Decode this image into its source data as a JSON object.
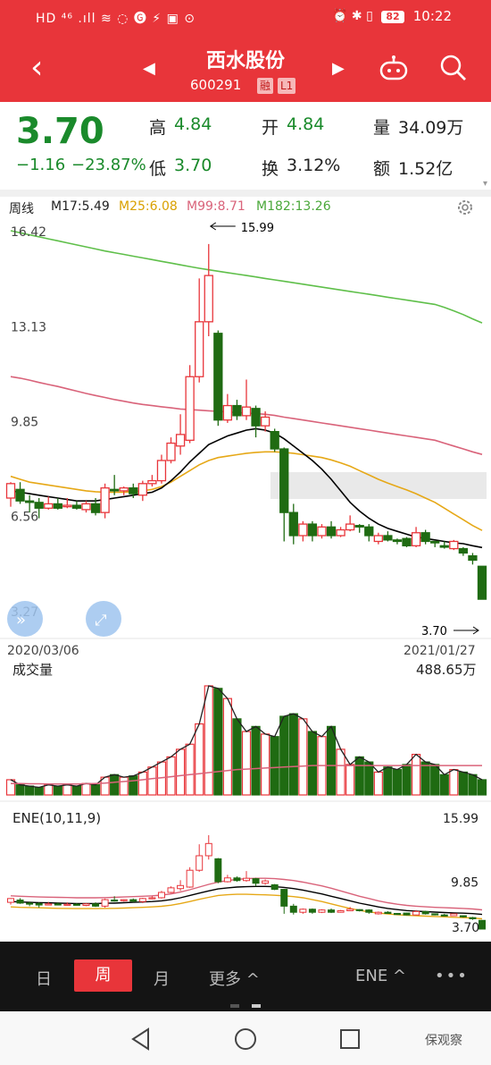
{
  "status": {
    "left": "HD ⁴⁶ .ıll ≋ ◌ 🅖 ⚡ ▣ ⊙",
    "icons": "⏰ ✱ ▯",
    "battery": "82",
    "time": "10:22"
  },
  "header": {
    "title": "西水股份",
    "code": "600291",
    "tag1": "融",
    "tag2": "L1",
    "back_icon": "back-arrow-icon",
    "prev_icon": "triangle-left-icon",
    "next_icon": "triangle-right-icon"
  },
  "quote": {
    "price": "3.70",
    "change": "−1.16",
    "pct": "−23.87%",
    "high_label": "高",
    "high": "4.84",
    "low_label": "低",
    "low": "3.70",
    "open_label": "开",
    "open": "4.84",
    "turn_label": "换",
    "turn": "3.12%",
    "vol_label": "量",
    "vol": "34.09万",
    "amt_label": "额",
    "amt": "1.52亿"
  },
  "ma": {
    "period": "周线",
    "m17": "M17:5.49",
    "m25": "M25:6.08",
    "m99": "M99:8.71",
    "m182": "M182:13.26"
  },
  "colors": {
    "red": "#e8353a",
    "up": "#e8353a",
    "down": "#1f6b12",
    "m17": "#000000",
    "m25": "#e6a817",
    "m99": "#d9637a",
    "m182": "#5fbf4a"
  },
  "chart_data": {
    "type": "candlestick",
    "price_axis_labels": [
      "16.42",
      "13.13",
      "9.85",
      "6.56",
      "3.27"
    ],
    "ylim": [
      3.27,
      16.42
    ],
    "start_date": "2020/03/06",
    "end_date": "2021/01/27",
    "max_label": "15.99",
    "min_label": "3.70",
    "candles": [
      [
        7.2,
        7.75,
        7.7,
        6.9
      ],
      [
        7.5,
        7.75,
        7.1,
        7.0
      ],
      [
        7.1,
        7.3,
        7.05,
        6.7
      ],
      [
        7.05,
        7.2,
        6.85,
        6.5
      ],
      [
        6.85,
        7.25,
        7.0,
        6.8
      ],
      [
        7.0,
        7.2,
        6.85,
        6.8
      ],
      [
        6.9,
        7.2,
        6.95,
        6.85
      ],
      [
        6.95,
        7.1,
        6.85,
        6.8
      ],
      [
        6.8,
        7.1,
        7.0,
        6.7
      ],
      [
        7.0,
        7.2,
        6.7,
        6.6
      ],
      [
        6.7,
        7.7,
        7.55,
        6.5
      ],
      [
        7.5,
        8.0,
        7.45,
        7.3
      ],
      [
        7.45,
        7.6,
        7.55,
        7.3
      ],
      [
        7.55,
        7.7,
        7.35,
        7.2
      ],
      [
        7.3,
        7.8,
        7.7,
        7.1
      ],
      [
        7.7,
        8.0,
        7.8,
        7.6
      ],
      [
        7.8,
        8.7,
        8.5,
        7.7
      ],
      [
        8.5,
        9.3,
        9.1,
        8.4
      ],
      [
        9.0,
        10.1,
        9.4,
        8.7
      ],
      [
        9.2,
        11.8,
        11.4,
        9.1
      ],
      [
        11.4,
        14.8,
        13.3,
        11.2
      ],
      [
        13.3,
        15.99,
        14.9,
        12.8
      ],
      [
        12.9,
        13.0,
        9.9,
        9.7
      ],
      [
        9.9,
        10.8,
        10.4,
        9.8
      ],
      [
        10.4,
        10.6,
        10.05,
        9.9
      ],
      [
        10.05,
        11.3,
        10.35,
        9.9
      ],
      [
        10.3,
        10.4,
        9.7,
        9.3
      ],
      [
        9.7,
        10.2,
        10.0,
        9.5
      ],
      [
        9.5,
        9.6,
        8.9,
        8.8
      ],
      [
        8.9,
        8.95,
        6.7,
        5.7
      ],
      [
        6.7,
        7.0,
        5.9,
        5.6
      ],
      [
        5.9,
        6.4,
        6.3,
        5.7
      ],
      [
        6.3,
        6.4,
        5.9,
        5.7
      ],
      [
        5.9,
        6.3,
        6.2,
        5.8
      ],
      [
        6.2,
        6.4,
        5.9,
        5.8
      ],
      [
        5.9,
        6.2,
        6.1,
        5.85
      ],
      [
        6.1,
        6.6,
        6.3,
        6.05
      ],
      [
        6.25,
        6.3,
        6.2,
        6.0
      ],
      [
        6.2,
        6.3,
        5.9,
        5.7
      ],
      [
        5.7,
        6.0,
        5.9,
        5.6
      ],
      [
        5.9,
        6.05,
        5.75,
        5.7
      ],
      [
        5.75,
        5.8,
        5.7,
        5.6
      ],
      [
        5.8,
        5.85,
        5.55,
        5.5
      ],
      [
        5.55,
        6.2,
        6.0,
        5.5
      ],
      [
        6.0,
        6.1,
        5.7,
        5.6
      ],
      [
        5.7,
        5.7,
        5.65,
        5.5
      ],
      [
        5.55,
        5.7,
        5.5,
        5.45
      ],
      [
        5.45,
        5.75,
        5.7,
        5.4
      ],
      [
        5.45,
        5.5,
        5.3,
        5.2
      ],
      [
        5.2,
        5.3,
        5.05,
        4.9
      ],
      [
        4.84,
        4.84,
        3.7,
        3.7
      ]
    ],
    "ma17": [
      7.45,
      7.4,
      7.35,
      7.3,
      7.25,
      7.2,
      7.15,
      7.1,
      7.1,
      7.1,
      7.15,
      7.2,
      7.25,
      7.3,
      7.35,
      7.4,
      7.55,
      7.8,
      8.1,
      8.45,
      8.75,
      9.05,
      9.2,
      9.35,
      9.45,
      9.55,
      9.6,
      9.55,
      9.45,
      9.25,
      9.0,
      8.75,
      8.5,
      8.2,
      7.85,
      7.45,
      7.05,
      6.75,
      6.5,
      6.3,
      6.15,
      6.05,
      5.95,
      5.85,
      5.8,
      5.75,
      5.7,
      5.65,
      5.62,
      5.55,
      5.49
    ],
    "ma25": [
      7.95,
      7.85,
      7.75,
      7.7,
      7.65,
      7.6,
      7.55,
      7.5,
      7.45,
      7.42,
      7.4,
      7.4,
      7.4,
      7.42,
      7.45,
      7.5,
      7.6,
      7.75,
      7.95,
      8.15,
      8.35,
      8.5,
      8.6,
      8.65,
      8.7,
      8.75,
      8.78,
      8.8,
      8.8,
      8.78,
      8.75,
      8.7,
      8.65,
      8.6,
      8.52,
      8.42,
      8.3,
      8.15,
      8.0,
      7.85,
      7.72,
      7.6,
      7.48,
      7.35,
      7.2,
      7.05,
      6.85,
      6.65,
      6.45,
      6.25,
      6.08
    ],
    "ma99": [
      11.4,
      11.35,
      11.28,
      11.2,
      11.13,
      11.06,
      10.98,
      10.9,
      10.82,
      10.75,
      10.68,
      10.61,
      10.55,
      10.49,
      10.44,
      10.4,
      10.36,
      10.32,
      10.28,
      10.26,
      10.24,
      10.22,
      10.2,
      10.18,
      10.16,
      10.14,
      10.12,
      10.1,
      10.06,
      10.0,
      9.95,
      9.9,
      9.85,
      9.8,
      9.75,
      9.7,
      9.65,
      9.6,
      9.55,
      9.5,
      9.45,
      9.4,
      9.35,
      9.3,
      9.25,
      9.2,
      9.1,
      9.0,
      8.9,
      8.8,
      8.71
    ],
    "ma182": [
      16.45,
      16.38,
      16.31,
      16.24,
      16.17,
      16.1,
      16.03,
      15.96,
      15.89,
      15.82,
      15.75,
      15.69,
      15.63,
      15.57,
      15.51,
      15.45,
      15.39,
      15.33,
      15.27,
      15.21,
      15.15,
      15.1,
      15.05,
      15.0,
      14.95,
      14.9,
      14.85,
      14.8,
      14.75,
      14.7,
      14.65,
      14.6,
      14.55,
      14.5,
      14.45,
      14.4,
      14.35,
      14.3,
      14.25,
      14.2,
      14.15,
      14.1,
      14.05,
      14.0,
      13.95,
      13.9,
      13.8,
      13.68,
      13.55,
      13.4,
      13.26
    ],
    "volume_title": "成交量",
    "volume_max_label": "488.65万",
    "volume": [
      60,
      40,
      35,
      30,
      40,
      35,
      40,
      35,
      45,
      40,
      70,
      80,
      70,
      75,
      90,
      110,
      130,
      150,
      180,
      200,
      280,
      430,
      420,
      380,
      300,
      250,
      270,
      240,
      230,
      310,
      320,
      300,
      250,
      230,
      270,
      180,
      120,
      150,
      130,
      90,
      110,
      100,
      120,
      160,
      130,
      120,
      80,
      100,
      90,
      80,
      60
    ],
    "volume_ma": [
      45,
      45,
      44,
      44,
      43,
      43,
      43,
      43,
      44,
      45,
      47,
      50,
      53,
      56,
      60,
      64,
      68,
      72,
      76,
      80,
      84,
      88,
      92,
      96,
      100,
      102,
      104,
      106,
      108,
      110,
      112,
      114,
      116,
      116,
      116,
      116,
      116,
      116,
      116,
      116,
      116,
      116,
      116,
      116,
      116,
      116,
      116,
      116,
      116,
      116,
      116
    ],
    "ene_title": "ENE(10,11,9)",
    "ene_labels": [
      "15.99",
      "9.85",
      "3.70"
    ],
    "ene_upper": [
      8.05,
      8.0,
      7.95,
      7.9,
      7.88,
      7.85,
      7.83,
      7.8,
      7.8,
      7.8,
      7.82,
      7.85,
      7.9,
      7.95,
      8.0,
      8.05,
      8.15,
      8.3,
      8.55,
      8.85,
      9.2,
      9.55,
      9.85,
      10.05,
      10.2,
      10.3,
      10.35,
      10.35,
      10.3,
      10.2,
      10.05,
      9.85,
      9.6,
      9.35,
      9.05,
      8.7,
      8.35,
      8.0,
      7.7,
      7.4,
      7.15,
      6.95,
      6.8,
      6.7,
      6.62,
      6.55,
      6.5,
      6.45,
      6.4,
      6.33,
      6.22
    ],
    "ene_mid": [
      7.3,
      7.25,
      7.2,
      7.17,
      7.14,
      7.1,
      7.07,
      7.05,
      7.05,
      7.05,
      7.08,
      7.1,
      7.15,
      7.2,
      7.25,
      7.3,
      7.4,
      7.55,
      7.8,
      8.1,
      8.4,
      8.7,
      8.95,
      9.1,
      9.2,
      9.25,
      9.28,
      9.28,
      9.25,
      9.15,
      9.0,
      8.8,
      8.55,
      8.3,
      8.0,
      7.7,
      7.4,
      7.1,
      6.85,
      6.6,
      6.4,
      6.25,
      6.12,
      6.05,
      5.98,
      5.92,
      5.86,
      5.82,
      5.78,
      5.72,
      5.62
    ],
    "ene_lower": [
      6.6,
      6.55,
      6.52,
      6.48,
      6.45,
      6.42,
      6.4,
      6.38,
      6.38,
      6.38,
      6.4,
      6.42,
      6.45,
      6.5,
      6.55,
      6.6,
      6.68,
      6.82,
      7.05,
      7.3,
      7.6,
      7.85,
      8.1,
      8.2,
      8.25,
      8.25,
      8.22,
      8.18,
      8.12,
      8.05,
      7.95,
      7.8,
      7.55,
      7.3,
      7.0,
      6.7,
      6.4,
      6.15,
      5.95,
      5.8,
      5.68,
      5.58,
      5.5,
      5.45,
      5.4,
      5.35,
      5.3,
      5.25,
      5.2,
      5.15,
      5.05
    ]
  },
  "bottom_tabs": {
    "day": "日",
    "week": "周",
    "month": "月",
    "more": "更多 ^",
    "ene": "ENE ^",
    "dots": "•••"
  },
  "watermark": "保观察"
}
